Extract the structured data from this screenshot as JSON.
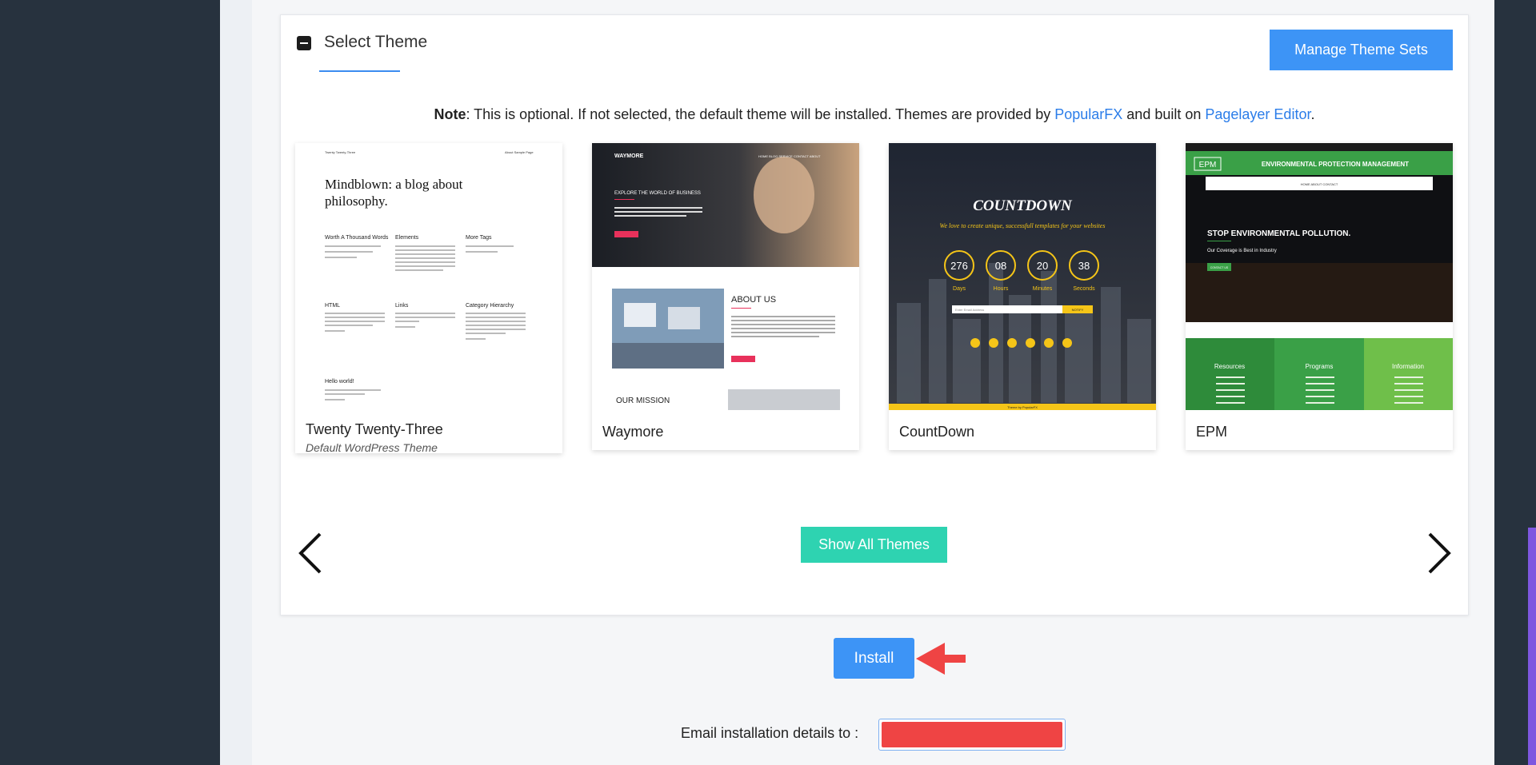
{
  "section": {
    "title": "Select Theme",
    "manage_button": "Manage Theme Sets"
  },
  "note": {
    "prefix": "Note",
    "text": ": This is optional. If not selected, the default theme will be installed. Themes are provided by ",
    "link1": "PopularFX",
    "middle": " and built on ",
    "link2": "Pagelayer Editor",
    "suffix": "."
  },
  "themes": [
    {
      "name": "Twenty Twenty-Three",
      "subtitle": "Default WordPress Theme",
      "preview": {
        "site_title": "Twenty Twenty-Three",
        "nav": "About   Sample Page",
        "headline1": "Mindblown: a blog about",
        "headline2": "philosophy.",
        "posts": [
          "Worth A Thousand Words",
          "Elements",
          "More Tags",
          "HTML",
          "Links",
          "Category Hierarchy",
          "Hello world!"
        ]
      }
    },
    {
      "name": "Waymore",
      "subtitle": "",
      "preview": {
        "brand": "WAYMORE",
        "menu": "HOME  BLOG  SERVICE  CONTACT  ABOUT",
        "hero": "EXPLORE THE WORLD OF BUSINESS",
        "about": "ABOUT US",
        "mission": "OUR MISSION"
      }
    },
    {
      "name": "CountDown",
      "subtitle": "",
      "preview": {
        "title": "COUNTDOWN",
        "tagline": "We love to create unique, successfull templates for your websites",
        "counters": [
          {
            "value": "276",
            "label": "Days"
          },
          {
            "value": "08",
            "label": "Hours"
          },
          {
            "value": "20",
            "label": "Minutes"
          },
          {
            "value": "38",
            "label": "Seconds"
          }
        ],
        "input_placeholder": "Enter Email Address",
        "button": "NOTIFY",
        "footer": "Theme by PopularFX"
      }
    },
    {
      "name": "EPM",
      "subtitle": "",
      "preview": {
        "logo": "EPM",
        "org": "ENVIRONMENTAL PROTECTION MANAGEMENT",
        "nav": "HOME    ABOUT    CONTACT",
        "hero": "STOP ENVIRONMENTAL POLLUTION.",
        "hero_sub": "Our Coverage is Best in Industry",
        "cta": "CONTACT US",
        "columns": [
          "Resources",
          "Programs",
          "Information"
        ]
      }
    }
  ],
  "show_all_button": "Show All Themes",
  "install_button": "Install",
  "email": {
    "label": "Email installation details to :",
    "value": ""
  },
  "colors": {
    "sidebar": "#27323e",
    "primary": "#3d94f6",
    "teal": "#2ed3b1",
    "link": "#2b7de9",
    "highlight_red": "#ef4444"
  }
}
